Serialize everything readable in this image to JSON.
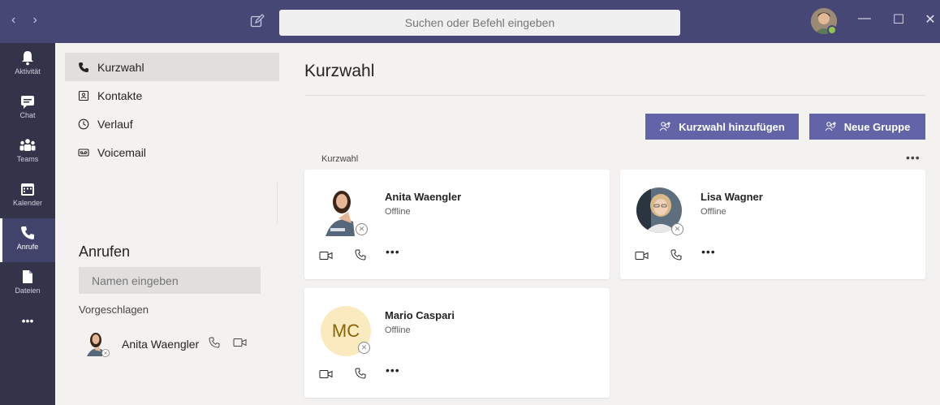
{
  "titlebar": {
    "nav_back": "‹",
    "nav_forward": "›",
    "search_placeholder": "Suchen oder Befehl eingeben",
    "win_minimize": "—",
    "win_maximize": "☐",
    "win_close": "✕",
    "status_color": "#92c353"
  },
  "rail": {
    "items": [
      {
        "label": "Aktivität",
        "icon": "bell-icon"
      },
      {
        "label": "Chat",
        "icon": "chat-icon"
      },
      {
        "label": "Teams",
        "icon": "teams-icon"
      },
      {
        "label": "Kalender",
        "icon": "calendar-icon"
      },
      {
        "label": "Anrufe",
        "icon": "phone-icon",
        "active": true
      },
      {
        "label": "Dateien",
        "icon": "file-icon"
      }
    ],
    "more": "•••"
  },
  "subnav": {
    "items": [
      {
        "label": "Kurzwahl",
        "icon": "phone-icon",
        "active": true
      },
      {
        "label": "Kontakte",
        "icon": "contact-card-icon"
      },
      {
        "label": "Verlauf",
        "icon": "clock-icon"
      },
      {
        "label": "Voicemail",
        "icon": "voicemail-icon"
      }
    ]
  },
  "call_panel": {
    "title": "Anrufen",
    "input_placeholder": "Namen eingeben",
    "suggested_label": "Vorgeschlagen",
    "suggested": [
      {
        "name": "Anita Waengler"
      }
    ]
  },
  "main": {
    "title": "Kurzwahl",
    "add_speed_dial_button": "Kurzwahl hinzufügen",
    "new_group_button": "Neue Gruppe",
    "section_label": "Kurzwahl",
    "section_more": "•••",
    "contacts": [
      {
        "name": "Anita Waengler",
        "status": "Offline"
      },
      {
        "name": "Lisa Wagner",
        "status": "Offline"
      },
      {
        "name": "Mario Caspari",
        "status": "Offline",
        "initials": "MC"
      }
    ],
    "more_dots": "•••"
  },
  "colors": {
    "accent": "#6264a7",
    "titlebar": "#464775",
    "rail": "#33344a"
  }
}
